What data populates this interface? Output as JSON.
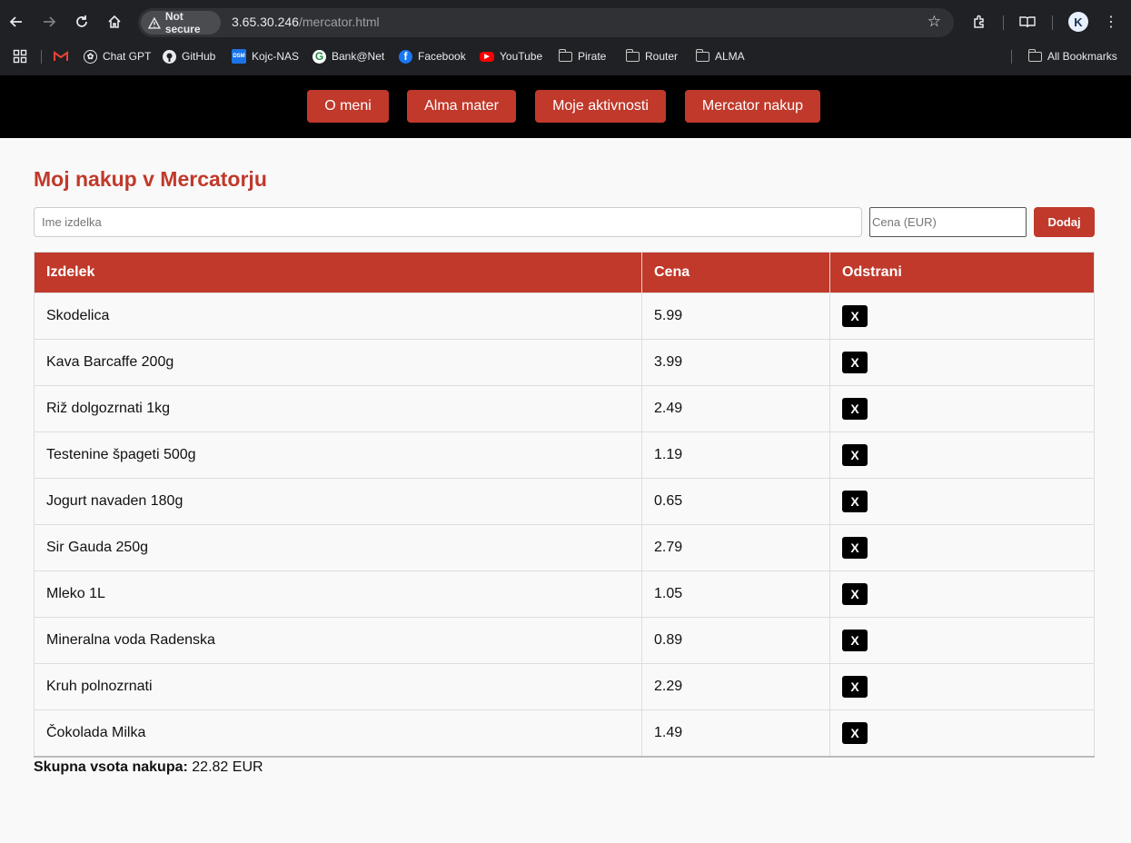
{
  "browser": {
    "security_label": "Not secure",
    "url_host": "3.65.30.246",
    "url_path": "/mercator.html",
    "profile_initial": "K",
    "bookmarks": [
      {
        "label": "",
        "icon": "gmail-icon"
      },
      {
        "label": "Chat GPT",
        "icon": "chatgpt-icon"
      },
      {
        "label": "GitHub",
        "icon": "github-icon"
      },
      {
        "label": "Kojc-NAS",
        "icon": "dsm-icon"
      },
      {
        "label": "Bank@Net",
        "icon": "bank-icon"
      },
      {
        "label": "Facebook",
        "icon": "facebook-icon"
      },
      {
        "label": "YouTube",
        "icon": "youtube-icon"
      },
      {
        "label": "Pirate",
        "icon": "folder-icon"
      },
      {
        "label": "Router",
        "icon": "folder-icon"
      },
      {
        "label": "ALMA",
        "icon": "folder-icon"
      }
    ],
    "all_bookmarks_label": "All Bookmarks"
  },
  "nav": {
    "items": [
      "O meni",
      "Alma mater",
      "Moje aktivnosti",
      "Mercator nakup"
    ]
  },
  "main": {
    "title": "Moj nakup v Mercatorju",
    "name_placeholder": "Ime izdelka",
    "price_placeholder": "Cena (EUR)",
    "add_label": "Dodaj",
    "table": {
      "headers": [
        "Izdelek",
        "Cena",
        "Odstrani"
      ],
      "remove_label": "X",
      "rows": [
        {
          "name": "Skodelica",
          "price": "5.99"
        },
        {
          "name": "Kava Barcaffe 200g",
          "price": "3.99"
        },
        {
          "name": "Riž dolgozrnati 1kg",
          "price": "2.49"
        },
        {
          "name": "Testenine špageti 500g",
          "price": "1.19"
        },
        {
          "name": "Jogurt navaden 180g",
          "price": "0.65"
        },
        {
          "name": "Sir Gauda 250g",
          "price": "2.79"
        },
        {
          "name": "Mleko 1L",
          "price": "1.05"
        },
        {
          "name": "Mineralna voda Radenska",
          "price": "0.89"
        },
        {
          "name": "Kruh polnozrnati",
          "price": "2.29"
        },
        {
          "name": "Čokolada Milka",
          "price": "1.49"
        }
      ]
    },
    "total_label": "Skupna vsota nakupa:",
    "total_value": "22.82 EUR"
  },
  "colors": {
    "accent": "#c0392b",
    "nav_bg": "#000000",
    "page_bg": "#f9f9f9"
  }
}
